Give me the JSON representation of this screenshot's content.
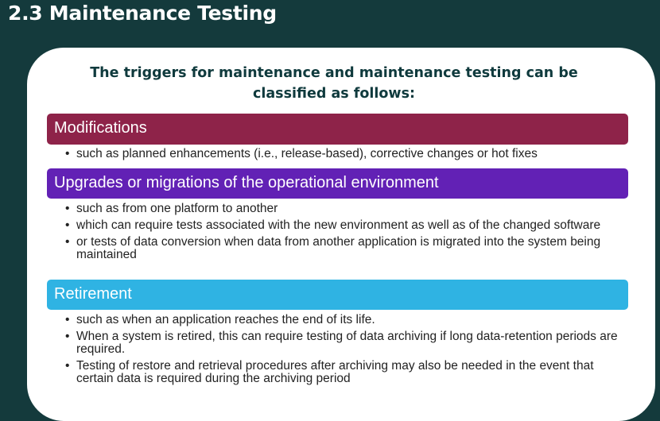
{
  "title": "2.3 Maintenance Testing",
  "intro": "The triggers for maintenance and maintenance testing can be classified as follows:",
  "sections": [
    {
      "heading": "Modifications",
      "color": "#8e2349",
      "bullets": [
        "such as planned enhancements (i.e., release-based), corrective changes or hot fixes"
      ]
    },
    {
      "heading": "Upgrades or migrations of the operational environment",
      "color": "#6221b5",
      "bullets": [
        "such as from one platform to another",
        "which can require tests associated with the new environment as well as of the changed software",
        "or tests of data conversion when data from another application is migrated into the system being maintained"
      ]
    },
    {
      "heading": "Retirement",
      "color": "#2fb3e3",
      "bullets": [
        "such as when an application reaches the end of its life.",
        "When a system is retired, this can require testing of data archiving if long data-retention periods are required.",
        "Testing of restore and retrieval procedures after archiving may also be needed in the event that certain data is required during the archiving period"
      ]
    }
  ]
}
